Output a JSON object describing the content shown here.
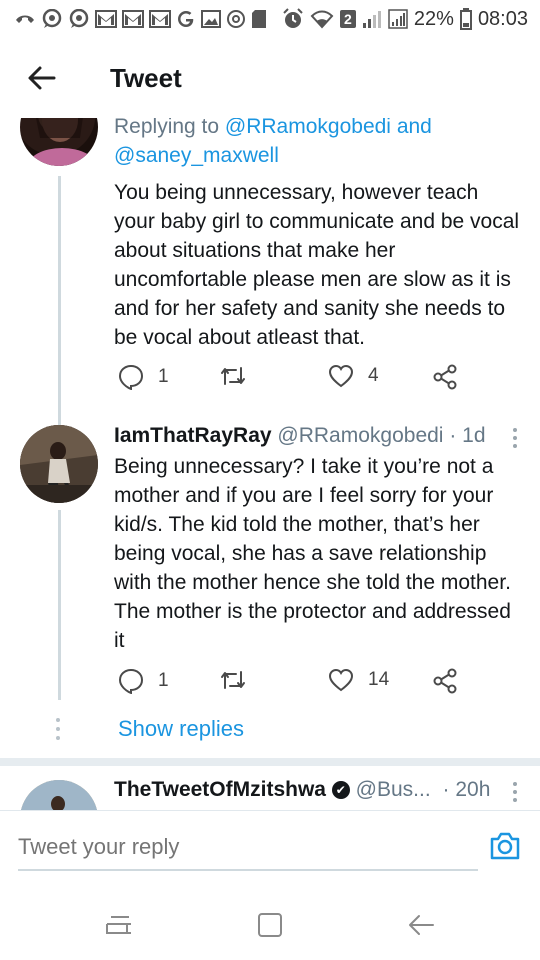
{
  "status_bar": {
    "sim_badge": "2",
    "battery_percent": "22%",
    "time": "08:03"
  },
  "header": {
    "title": "Tweet"
  },
  "tweet1": {
    "replying_label": "Replying to",
    "replying_to_1": "@RRamokgobedi",
    "replying_and": "and",
    "replying_to_2": "@saney_maxwell",
    "text": "You being unnecessary, however teach your baby girl to communicate and be vocal about situations that make her uncomfortable please men are slow as it is and for her safety and sanity she needs to be vocal about atleast that.",
    "reply_count": "1",
    "retweet_count": "",
    "like_count": "4"
  },
  "tweet2": {
    "author": "IamThatRayRay",
    "handle": "@RRamokgobedi",
    "time": "· 1d",
    "text": "Being unnecessary? I take it you’re not a mother and if you are I feel sorry for your kid/s. The kid told the mother, that’s her being vocal, she has a save relationship with the mother hence she told the mother. The mother is the protector and addressed it",
    "reply_count": "1",
    "retweet_count": "",
    "like_count": "14"
  },
  "show_replies": "Show replies",
  "tweet3": {
    "author": "TheTweetOfMzitshwa",
    "handle": "@Bus...",
    "time": "· 20h"
  },
  "reply_bar": {
    "placeholder": "Tweet your reply"
  },
  "colors": {
    "link": "#1b95e0",
    "secondary_text": "#657786",
    "icon_gray": "#4a4a4a"
  }
}
